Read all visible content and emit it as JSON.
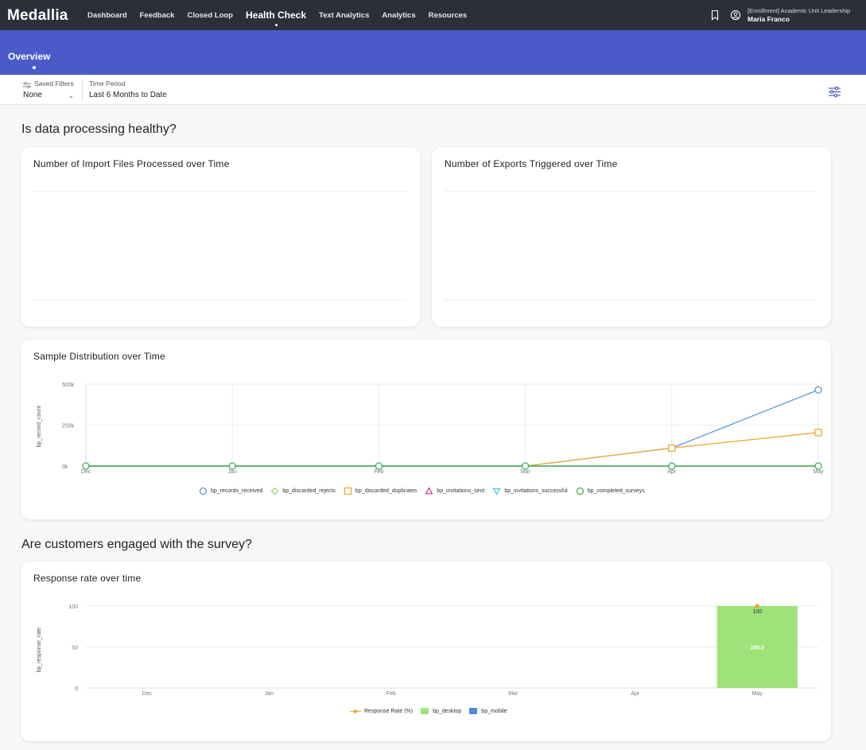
{
  "app": {
    "logo": "Medallia"
  },
  "nav": {
    "items": [
      "Dashboard",
      "Feedback",
      "Closed Loop",
      "Health Check",
      "Text Analytics",
      "Analytics",
      "Resources"
    ],
    "active": "Health Check"
  },
  "user": {
    "role": "[Enrollment] Academic Unit Leadership",
    "name": "Maria Franco"
  },
  "subnav": {
    "tab": "Overview"
  },
  "filters": {
    "saved_label": "Saved Filters",
    "saved_value": "None",
    "period_label": "Time Period",
    "period_value": "Last 6 Months to Date"
  },
  "sections": {
    "processing": "Is data processing healthy?",
    "engagement": "Are customers engaged with the survey?"
  },
  "cards": {
    "imports_title": "Number of Import Files Processed over Time",
    "exports_title": "Number of Exports Triggered over Time",
    "sample_title": "Sample Distribution over Time",
    "response_title": "Response rate over time"
  },
  "colors": {
    "topbar": "#2b2f3a",
    "subbar": "#4a5bc9",
    "records_received": "#5b9bd5",
    "discarded_rejects": "#8fd16a",
    "discarded_duplicates": "#f0a830",
    "invitations_sent": "#d6338a",
    "invitations_successful": "#35c6d8",
    "completed_surveys": "#3cb44b",
    "desktop": "#9fe27a",
    "mobile": "#4a90e2",
    "response_rate": "#f0a830"
  },
  "chart_data": [
    {
      "type": "line",
      "ylabel": "bp_record_count",
      "x": [
        "Dec",
        "Jan",
        "Feb",
        "Mar",
        "Apr",
        "May"
      ],
      "yticks": [
        "0k",
        "250k",
        "500k"
      ],
      "ylim": [
        0,
        500000
      ],
      "legend_position": "bottom",
      "series": [
        {
          "name": "bp_records_received",
          "marker": "circle",
          "values": [
            0,
            0,
            0,
            0,
            110000,
            465000
          ]
        },
        {
          "name": "bp_discarded_rejects",
          "marker": "diamond",
          "values": [
            0,
            0,
            0,
            0,
            0,
            0
          ]
        },
        {
          "name": "bp_discarded_duplicates",
          "marker": "square",
          "values": [
            0,
            0,
            0,
            0,
            110000,
            205000
          ]
        },
        {
          "name": "bp_invitations_sent",
          "marker": "triangle",
          "values": [
            0,
            0,
            0,
            0,
            0,
            0
          ]
        },
        {
          "name": "bp_invitations_successful",
          "marker": "triangle-down",
          "values": [
            0,
            0,
            0,
            0,
            0,
            0
          ]
        },
        {
          "name": "bp_completed_surveys",
          "marker": "circle",
          "values": [
            0,
            0,
            0,
            0,
            0,
            0
          ]
        }
      ]
    },
    {
      "type": "bar",
      "ylabel": "bp_response_rate",
      "categories": [
        "Dec",
        "Jan",
        "Feb",
        "Mar",
        "Apr",
        "May"
      ],
      "yticks": [
        "0",
        "50",
        "100"
      ],
      "ylim": [
        0,
        100
      ],
      "legend_position": "bottom",
      "series": [
        {
          "name": "Response Rate (%)",
          "kind": "line",
          "values": [
            null,
            null,
            null,
            null,
            null,
            100
          ]
        },
        {
          "name": "bp_desktop",
          "kind": "bar",
          "values": [
            0,
            0,
            0,
            0,
            0,
            100
          ]
        },
        {
          "name": "bp_mobile",
          "kind": "bar",
          "values": [
            0,
            0,
            0,
            0,
            0,
            0
          ]
        }
      ],
      "data_labels": {
        "line": "100",
        "bar": "100.0"
      }
    }
  ]
}
